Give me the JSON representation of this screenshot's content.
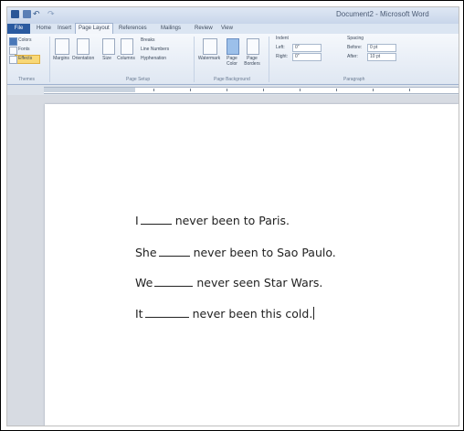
{
  "window": {
    "title": "Document2 - Microsoft Word"
  },
  "tabs": [
    "Home",
    "Insert",
    "Page Layout",
    "References",
    "Mailings",
    "Review",
    "View"
  ],
  "file_tab": "File",
  "active_tab": "Page Layout",
  "ribbon": {
    "themes": {
      "colors": "Colors",
      "fonts": "Fonts",
      "effects": "Effects",
      "label": "Themes"
    },
    "page_setup": {
      "margins": "Margins",
      "orientation": "Orientation",
      "size": "Size",
      "columns": "Columns",
      "breaks": "Breaks",
      "line_numbers": "Line Numbers",
      "hyphenation": "Hyphenation",
      "label": "Page Setup"
    },
    "page_background": {
      "watermark": "Watermark",
      "page_color": "Page Color",
      "page_borders": "Page Borders",
      "label": "Page Background"
    },
    "paragraph": {
      "indent": "Indent",
      "left_label": "Left:",
      "left_value": "0\"",
      "right_label": "Right:",
      "right_value": "0\"",
      "spacing": "Spacing",
      "before_label": "Before:",
      "before_value": "0 pt",
      "after_label": "After:",
      "after_value": "10 pt",
      "label": "Paragraph"
    }
  },
  "document": {
    "lines": [
      {
        "subject": "I",
        "rest": "never been to Paris."
      },
      {
        "subject": "She",
        "rest": "never been to Sao Paulo."
      },
      {
        "subject": "We",
        "rest": "never seen Star Wars."
      },
      {
        "subject": "It",
        "rest": "never been this cold."
      }
    ]
  }
}
